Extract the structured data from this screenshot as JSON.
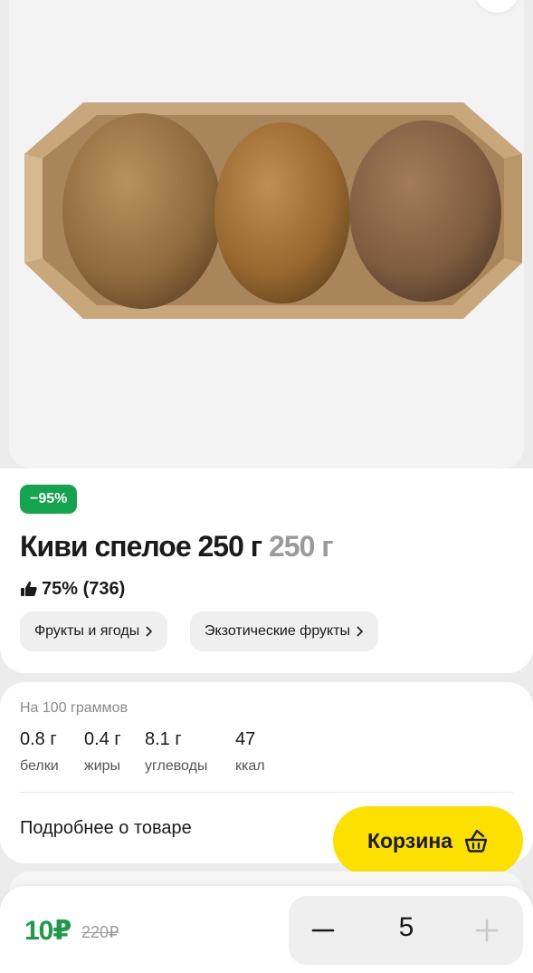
{
  "product": {
    "discount": "−95%",
    "title": "Киви спелое 250 г",
    "title_weight": "250 г",
    "rating": "75% (736)",
    "image_alt": "kiwi-in-tray"
  },
  "categories": [
    {
      "label": "Фрукты и ягоды"
    },
    {
      "label": "Экзотические фрукты"
    }
  ],
  "nutrition": {
    "per_label": "На 100 граммов",
    "items": [
      {
        "value": "0.8 г",
        "label": "белки"
      },
      {
        "value": "0.4 г",
        "label": "жиры"
      },
      {
        "value": "8.1 г",
        "label": "углеводы"
      },
      {
        "value": "47",
        "label": "ккал"
      }
    ],
    "more_link": "Подробнее о товаре"
  },
  "cart": {
    "label": "Корзина",
    "icon": "basket-icon"
  },
  "bottom": {
    "price_now": "10₽",
    "price_old": "220₽",
    "quantity": "5"
  },
  "colors": {
    "accent_yellow": "#fce000",
    "discount_green": "#14a44d",
    "price_green": "#1f9a4a"
  }
}
